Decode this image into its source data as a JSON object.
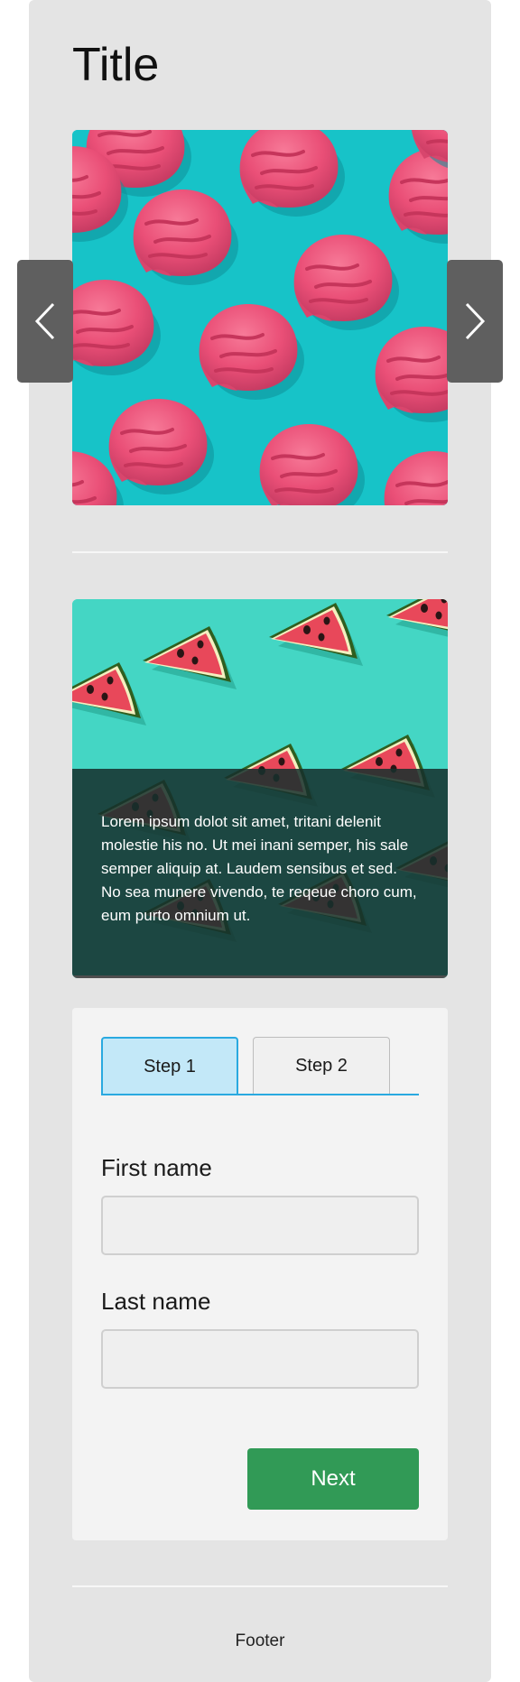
{
  "page": {
    "title": "Title"
  },
  "carousel": {
    "slide_description": "pink-ice-cream-scoops-on-teal",
    "prev_icon": "chevron-left-icon",
    "next_icon": "chevron-right-icon"
  },
  "card": {
    "image_description": "watermelon-slices-on-mint",
    "caption": "Lorem ipsum dolot sit amet, tritani delenit molestie his no. Ut mei inani semper, his sale semper aliquip at. Laudem sensibus et sed. No sea munere vivendo, te reqeue choro cum, eum purto omnium ut."
  },
  "form": {
    "tabs": [
      {
        "label": "Step 1",
        "active": true
      },
      {
        "label": "Step 2",
        "active": false
      }
    ],
    "first_name": {
      "label": "First name",
      "value": "",
      "placeholder": ""
    },
    "last_name": {
      "label": "Last name",
      "value": "",
      "placeholder": ""
    },
    "next_label": "Next"
  },
  "footer": {
    "text": "Footer"
  },
  "colors": {
    "panel": "#e4e4e4",
    "accent_blue": "#29a9e0",
    "active_tab": "#c3e8f8",
    "next_button": "#319a56",
    "carousel_bg": "#17c3c8",
    "scoop_pink": "#f0577f",
    "card_bg": "#44d6c4",
    "watermelon_red": "#e8485a"
  }
}
